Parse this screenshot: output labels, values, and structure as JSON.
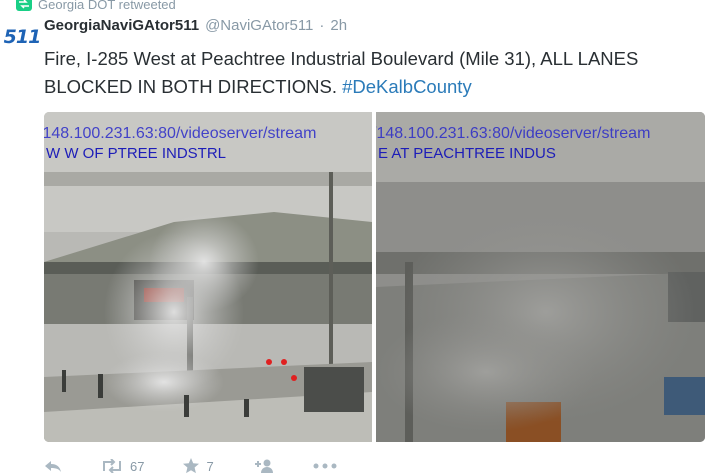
{
  "retweet": {
    "label": "Georgia DOT retweeted",
    "icon": "retweet-icon"
  },
  "author": {
    "avatar_text": "511",
    "display_name": "GeorgiaNaviGAtor511",
    "handle": "@NaviGAtor511",
    "separator": "·",
    "timestamp": "2h"
  },
  "tweet": {
    "text": "Fire, I-285 West at Peachtree Industrial Boulevard (Mile 31), ALL LANES BLOCKED IN BOTH DIRECTIONS.",
    "hashtag": "#DeKalbCounty"
  },
  "media": {
    "image1": {
      "url": "/148.100.231.63:80/videoserver/stream",
      "location": "W W OF PTREE INDSTRL"
    },
    "image2": {
      "url": "/148.100.231.63:80/videoserver/stream",
      "location": "E AT PEACHTREE INDUS"
    }
  },
  "actions": {
    "reply": {
      "icon": "reply-icon"
    },
    "retweet": {
      "icon": "retweet-icon",
      "count": "67"
    },
    "like": {
      "icon": "star-icon",
      "count": "7"
    },
    "follow": {
      "icon": "follow-icon"
    },
    "more": {
      "icon": "more-icon"
    }
  },
  "colors": {
    "link": "#2b7bb9",
    "muted": "#8899a6",
    "text": "#292f33",
    "retweet_green": "#19cf86",
    "brand_blue": "#1e63b5"
  }
}
